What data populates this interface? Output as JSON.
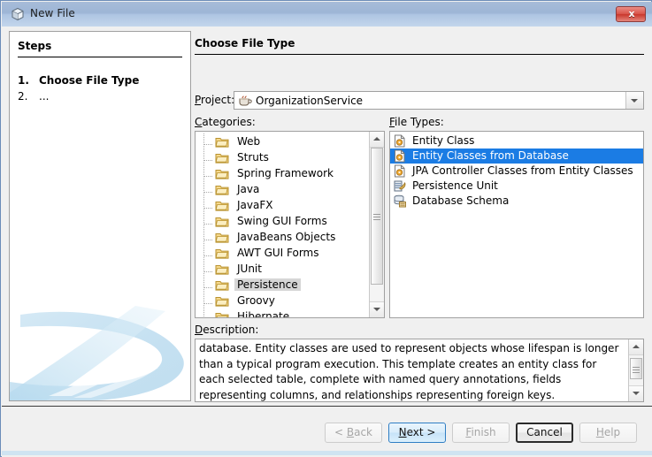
{
  "window": {
    "title": "New File",
    "title_icon": "cube-icon",
    "close_label": "x"
  },
  "steps": {
    "heading": "Steps",
    "items": [
      {
        "number": "1.",
        "label": "Choose File Type",
        "current": true
      },
      {
        "number": "2.",
        "label": "...",
        "current": false
      }
    ]
  },
  "pane": {
    "title": "Choose File Type",
    "project_label": "Project:",
    "project_value": "OrganizationService",
    "project_icon": "coffee-cup-icon",
    "categories_label": "Categories:",
    "file_types_label": "File Types:",
    "description_label": "Description:"
  },
  "categories": {
    "items": [
      {
        "label": "Web",
        "icon": "folder-icon",
        "selected": false
      },
      {
        "label": "Struts",
        "icon": "folder-icon",
        "selected": false
      },
      {
        "label": "Spring Framework",
        "icon": "folder-icon",
        "selected": false
      },
      {
        "label": "Java",
        "icon": "folder-icon",
        "selected": false
      },
      {
        "label": "JavaFX",
        "icon": "folder-icon",
        "selected": false
      },
      {
        "label": "Swing GUI Forms",
        "icon": "folder-icon",
        "selected": false
      },
      {
        "label": "JavaBeans Objects",
        "icon": "folder-icon",
        "selected": false
      },
      {
        "label": "AWT GUI Forms",
        "icon": "folder-icon",
        "selected": false
      },
      {
        "label": "JUnit",
        "icon": "folder-icon",
        "selected": false
      },
      {
        "label": "Persistence",
        "icon": "folder-icon",
        "selected": true
      },
      {
        "label": "Groovy",
        "icon": "folder-icon",
        "selected": false
      },
      {
        "label": "Hibernate",
        "icon": "folder-icon",
        "selected": false
      }
    ]
  },
  "file_types": {
    "items": [
      {
        "label": "Entity Class",
        "icon": "entity-class-icon",
        "selected": false
      },
      {
        "label": "Entity Classes from Database",
        "icon": "entity-class-icon",
        "selected": true
      },
      {
        "label": "JPA Controller Classes from Entity Classes",
        "icon": "entity-class-icon",
        "selected": false
      },
      {
        "label": "Persistence Unit",
        "icon": "persistence-unit-icon",
        "selected": false
      },
      {
        "label": "Database Schema",
        "icon": "database-schema-icon",
        "selected": false
      }
    ]
  },
  "description": {
    "text": "database. Entity classes are used to represent objects whose lifespan is longer than a typical program execution. This template creates an entity class for each selected table, complete with named query annotations, fields representing columns, and relationships representing foreign keys."
  },
  "buttons": [
    {
      "label": "< Back",
      "mnemonic": "B",
      "state": "disabled"
    },
    {
      "label": "Next >",
      "mnemonic": "N",
      "state": "default"
    },
    {
      "label": "Finish",
      "mnemonic": "F",
      "state": "disabled"
    },
    {
      "label": "Cancel",
      "mnemonic": "",
      "state": "focused"
    },
    {
      "label": "Help",
      "mnemonic": "H",
      "state": "disabled"
    }
  ],
  "colors": {
    "selection_blue": "#1b7ce4",
    "selection_gray": "#d6d6d6",
    "titlebar_blue": "#9db5d6",
    "close_red": "#d9544a",
    "accent_strip": "#cfe4f2"
  }
}
